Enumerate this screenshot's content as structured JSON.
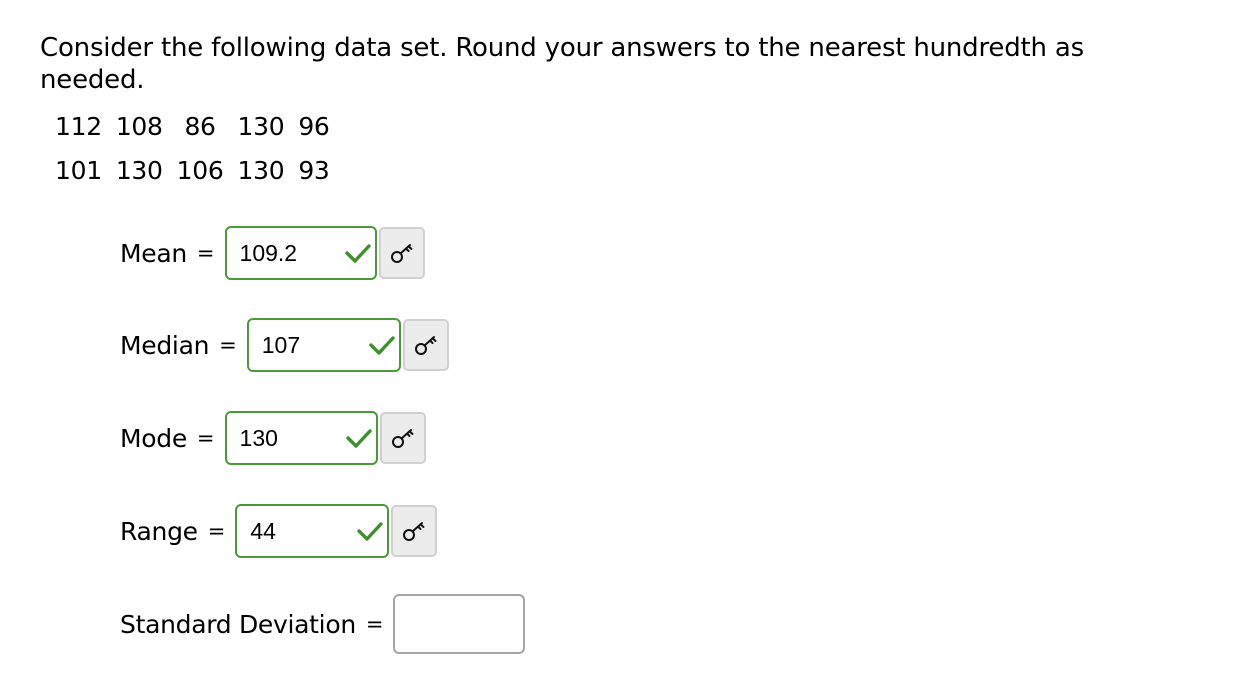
{
  "question": {
    "instructions": "Consider the following data set. Round your answers to the nearest hundredth as needed.",
    "data_rows": [
      [
        "112",
        "108",
        "86",
        "130",
        "96"
      ],
      [
        "101",
        "130",
        "106",
        "130",
        "93"
      ]
    ]
  },
  "answers": [
    {
      "label": "Mean",
      "equals": "=",
      "value": "109.2",
      "status": "correct",
      "show_key": true
    },
    {
      "label": "Median",
      "equals": "=",
      "value": "107",
      "status": "correct",
      "show_key": true
    },
    {
      "label": "Mode",
      "equals": "=",
      "value": "130",
      "status": "correct",
      "show_key": true
    },
    {
      "label": "Range",
      "equals": "=",
      "value": "44",
      "status": "correct",
      "show_key": true
    },
    {
      "label": "Standard Deviation",
      "equals": "=",
      "value": "",
      "status": "unanswered",
      "show_key": false
    }
  ],
  "colors": {
    "correct_border": "#4a9a38",
    "checkmark": "#3f8f2e",
    "empty_border": "#a6a6a6",
    "key_button_bg": "#ececec"
  },
  "icons": {
    "correct": "checkmark-icon",
    "key": "key-icon"
  }
}
